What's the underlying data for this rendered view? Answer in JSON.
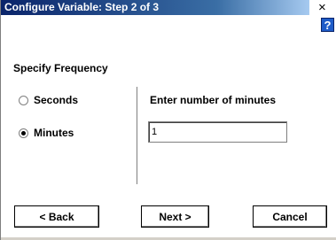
{
  "window": {
    "title": "Configure Variable: Step 2 of 3",
    "close_glyph": "×",
    "help_glyph": "?"
  },
  "section": {
    "title": "Specify Frequency"
  },
  "options": [
    {
      "label": "Seconds",
      "selected": false
    },
    {
      "label": "Minutes",
      "selected": true
    }
  ],
  "minutes_field": {
    "label": "Enter number of minutes",
    "value": "1"
  },
  "buttons": {
    "back": "< Back",
    "next": "Next >",
    "cancel": "Cancel"
  },
  "colors": {
    "titlebar_start": "#0a246a",
    "titlebar_end": "#a6caf0",
    "help_icon": "#1f5cc8"
  }
}
